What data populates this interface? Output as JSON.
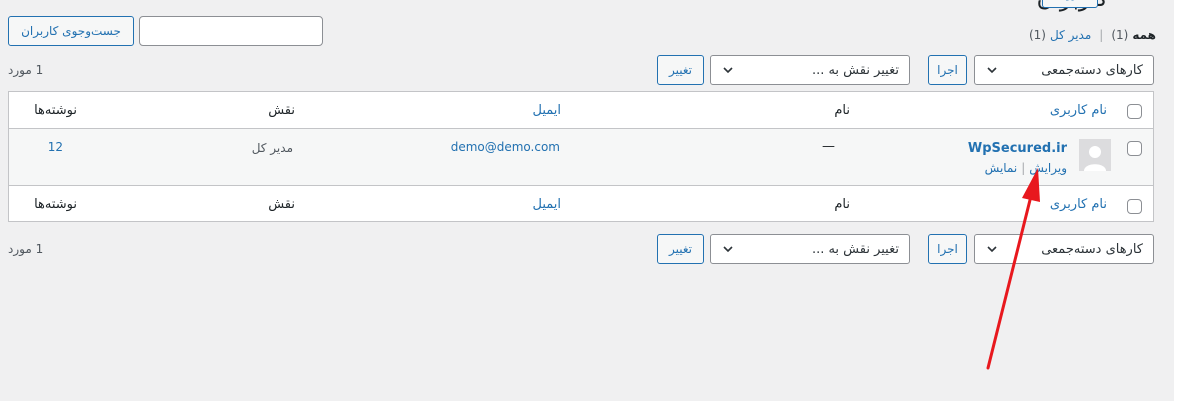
{
  "header": {
    "title": "کاربران",
    "add_button": "افزودن"
  },
  "search": {
    "button_label": "جست‌وجوی کاربران",
    "placeholder": ""
  },
  "filters": {
    "all_label": "همه",
    "all_count": "(1)",
    "separator": "|",
    "admin_label": "مدیر کل",
    "admin_count": "(1)"
  },
  "top_nav": {
    "bulk_select": "کارهای دسته‌جمعی",
    "apply": "اجرا",
    "role_select": "تغییر نقش به ...",
    "change": "تغییر",
    "count": "1 مورد"
  },
  "bottom_nav": {
    "bulk_select": "کارهای دسته‌جمعی",
    "apply": "اجرا",
    "role_select": "تغییر نقش به ...",
    "change": "تغییر",
    "count": "1 مورد"
  },
  "table": {
    "columns": {
      "username": "نام کاربری",
      "name": "نام",
      "email": "ایمیل",
      "role": "نقش",
      "posts": "نوشته‌ها"
    },
    "rows": [
      {
        "username": "WpSecured.ir",
        "name": "—",
        "email": "demo@demo.com",
        "role": "مدیر کل",
        "posts": "12",
        "actions": {
          "edit": "ویرایش",
          "sep": "|",
          "view": "نمایش"
        }
      }
    ]
  },
  "colors": {
    "accent": "#2271b1",
    "arrow": "#e8181e",
    "background": "#f0f0f1"
  }
}
